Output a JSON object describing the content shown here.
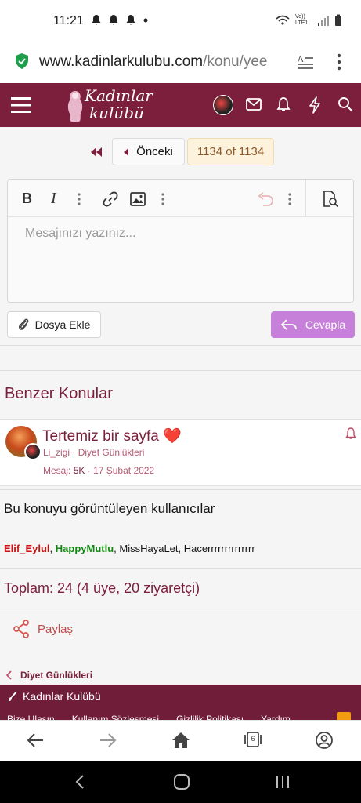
{
  "status_bar": {
    "time": "11:21",
    "network": "Vo)) LTE1"
  },
  "browser": {
    "url_host": "www.kadinlarkulubu.com",
    "url_path": "/konu/yee",
    "tab_count": "6"
  },
  "site": {
    "logo_line1": "Kadınlar",
    "logo_line2": "kulübü"
  },
  "pagination": {
    "prev_label": "Önceki",
    "page_indicator": "1134 of 1134"
  },
  "editor": {
    "placeholder": "Mesajınızı yazınız...",
    "attach_label": "Dosya Ekle",
    "reply_label": "Cevapla"
  },
  "similar": {
    "title": "Benzer Konular",
    "thread": {
      "title": "Tertemiz bir sayfa",
      "heart": "❤️",
      "author": "Li_zigi",
      "forum": "Diyet Günlükleri",
      "replies_label": "Mesaj:",
      "replies_value": "5K",
      "date": "17 Şubat 2022"
    }
  },
  "viewers": {
    "title": "Bu konuyu görüntüleyen kullanıcılar",
    "user1": "Elif_Eylul",
    "user2": "HappyMutlu",
    "rest": ", MissHayaLet, Hacerrrrrrrrrrrrrr",
    "total": "Toplam: 24 (4 üye, 20 ziyaretçi)"
  },
  "share": {
    "label": "Paylaş"
  },
  "breadcrumb": {
    "label": "Diyet Günlükleri"
  },
  "footer": {
    "site_name": "Kadınlar Kulübü",
    "links": [
      "Bize Ulaşın",
      "Kullanım Sözleşmesi",
      "Gizlilik Politikası",
      "Yardım"
    ]
  },
  "colors": {
    "brand": "#7b1f3c",
    "reply_button": "#c680d9",
    "user1_color": "#cc1111",
    "user2_color": "#118811"
  }
}
